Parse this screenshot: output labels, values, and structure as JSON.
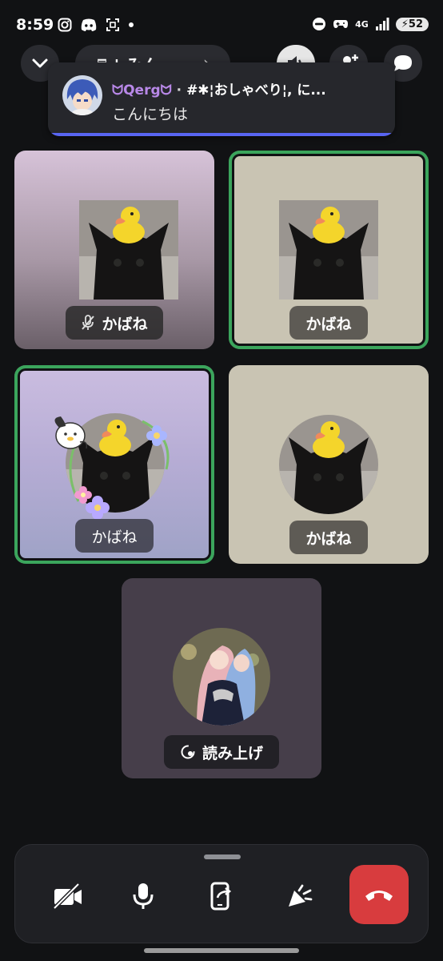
{
  "status_bar": {
    "time": "8:59",
    "network": "4G",
    "battery": "52",
    "icons": [
      "instagram-icon",
      "discord-icon",
      "screenshot-icon",
      "dot-icon",
      "dnd-icon",
      "game-icon",
      "signal-icon",
      "battery-icon"
    ]
  },
  "header": {
    "channel_name": "♬ ¦ みん…",
    "buttons": [
      "collapse-chevron",
      "speaker",
      "add-user",
      "chat"
    ]
  },
  "notification": {
    "sender": "ᗢQergᗢ",
    "separator": " · ",
    "channel": "#✱¦おしゃべり¦, に...",
    "message": "こんにちは",
    "accent": "#5865f2"
  },
  "participants": [
    {
      "name": "かばね",
      "muted": true,
      "speaking": false
    },
    {
      "name": "かばね",
      "muted": false,
      "speaking": true
    },
    {
      "name": "かばね",
      "muted": false,
      "speaking": true
    },
    {
      "name": "かばね",
      "muted": false,
      "speaking": false
    },
    {
      "name": "読み上げ",
      "muted": false,
      "speaking": false,
      "bot": true
    }
  ],
  "controls": {
    "buttons": [
      "camera-off",
      "microphone",
      "screen-share",
      "soundboard",
      "end-call"
    ],
    "end_color": "#d83c3e"
  },
  "colors": {
    "background": "#111214",
    "speaking_ring": "#3ba55c"
  }
}
